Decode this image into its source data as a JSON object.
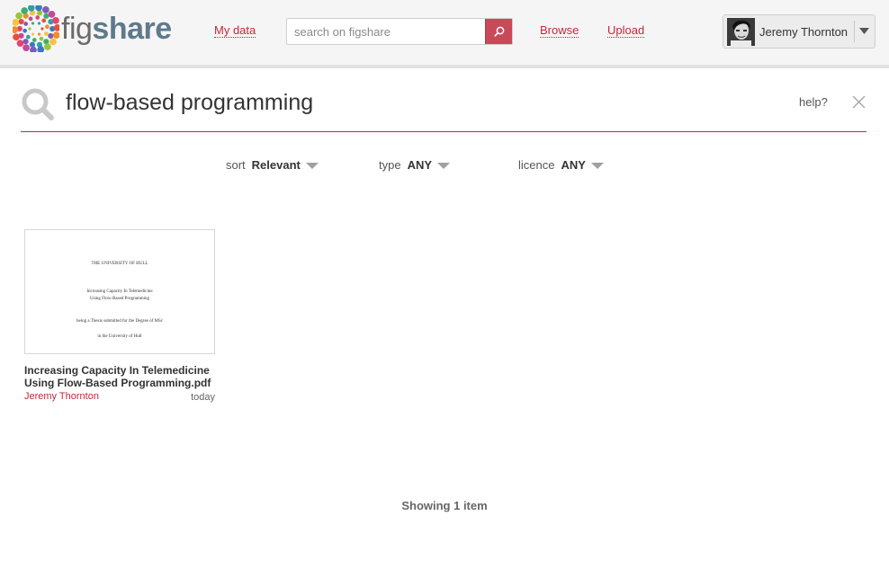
{
  "header": {
    "logo_text_fig": "fig",
    "logo_text_share": "share",
    "nav": {
      "my_data": "My data",
      "browse": "Browse",
      "upload": "Upload"
    },
    "search": {
      "placeholder": "search on figshare",
      "value": ""
    },
    "user": {
      "name": "Jeremy Thornton"
    }
  },
  "search_bar": {
    "query": "flow-based programming",
    "help": "help?"
  },
  "filters": {
    "sort": {
      "label": "sort",
      "value": "Relevant"
    },
    "type": {
      "label": "type",
      "value": "ANY"
    },
    "licence": {
      "label": "licence",
      "value": "ANY"
    }
  },
  "results": [
    {
      "title": "Increasing Capacity In Telemedicine Using Flow-Based Programming.pdf",
      "author": "Jeremy Thornton",
      "date": "today",
      "thumbnail_lines": [
        "THE UNIVERSITY OF HULL",
        "Increasing Capacity In Telemedicine",
        "Using Flow-Based Programming",
        "being a Thesis submitted for the Degree of MSc",
        "in the University of Hull"
      ]
    }
  ],
  "footer": {
    "showing": "Showing 1 item"
  },
  "colors": {
    "accent": "#c4283b",
    "search_button": "#c84a58",
    "header_bg": "#f5f5f5"
  }
}
